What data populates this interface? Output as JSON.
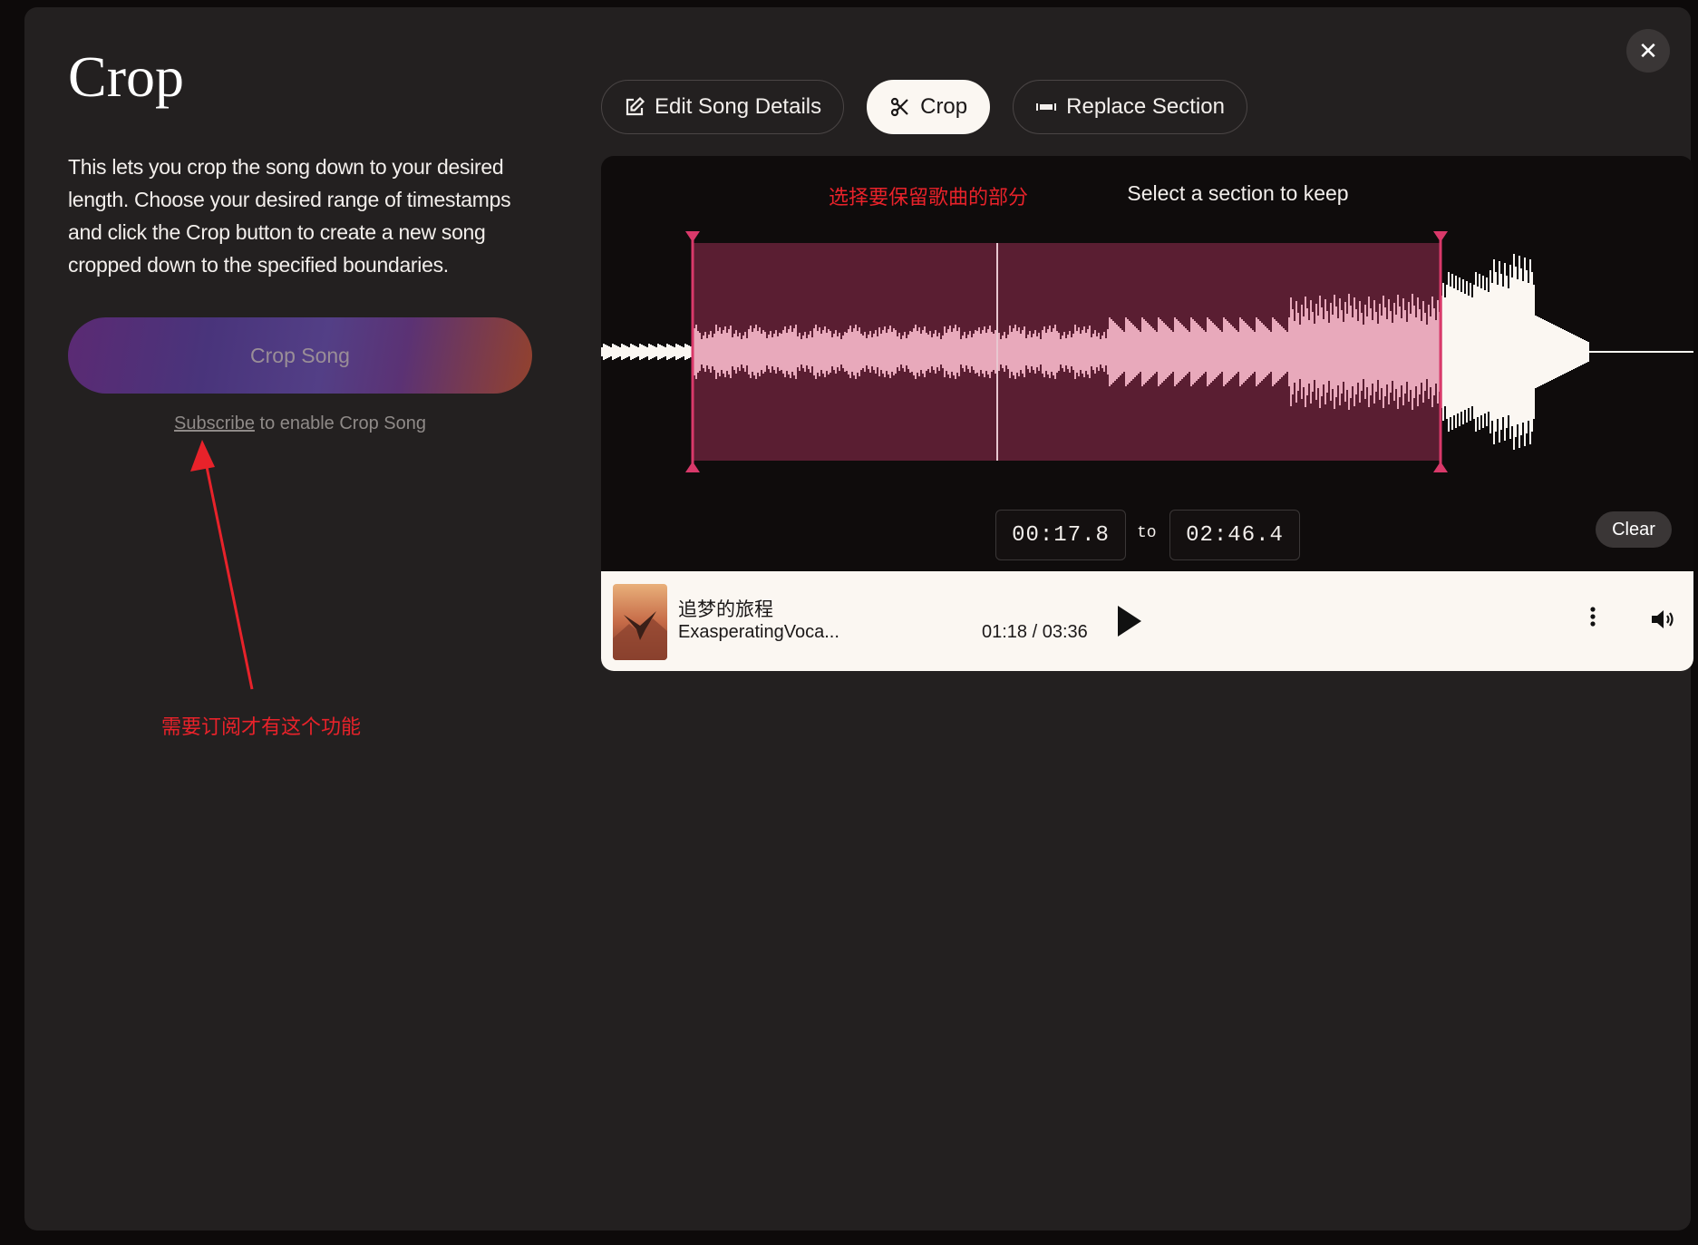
{
  "modal": {
    "title": "Crop",
    "description": "This lets you crop the song down to your desired length. Choose your desired range of timestamps and click the Crop button to create a new song cropped down to the specified boundaries.",
    "crop_button_label": "Crop Song",
    "subscribe_link": "Subscribe",
    "subscribe_suffix": " to enable Crop Song",
    "close_icon": "close-icon"
  },
  "tabs": [
    {
      "label": "Edit Song Details",
      "icon": "edit-icon",
      "active": false
    },
    {
      "label": "Crop",
      "icon": "scissors-icon",
      "active": true
    },
    {
      "label": "Replace Section",
      "icon": "replace-section-icon",
      "active": false
    }
  ],
  "editor": {
    "select_label": "Select a section to keep",
    "start_time": "00:17.8",
    "to_label": "to",
    "end_time": "02:46.4",
    "clear_label": "Clear"
  },
  "player": {
    "song_title": "追梦的旅程",
    "artist": "ExasperatingVoca...",
    "time": "01:18 / 03:36",
    "play_icon": "play-icon",
    "more_icon": "more-vertical-icon",
    "volume_icon": "volume-icon"
  },
  "annotations": {
    "wave_note": "选择要保留歌曲的部分",
    "subscribe_note": "需要订阅才有这个功能"
  },
  "colors": {
    "annotation": "#e8222a",
    "selection": "#5a1e32",
    "selection_handle": "#d9396a",
    "selected_wave": "#e8a9bb",
    "wave": "#fbf7f2"
  }
}
